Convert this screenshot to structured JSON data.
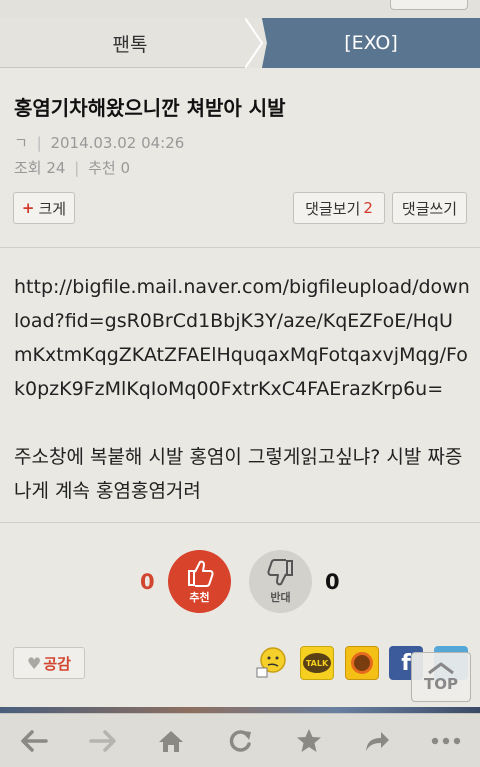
{
  "breadcrumb": {
    "home": "팬톡",
    "current": "[EXO]"
  },
  "post": {
    "title": "홍염기차해왔으니깐 쳐받아 시발",
    "author": "ㄱ",
    "date": "2014.03.02 04:26",
    "views_label": "조회",
    "views": "24",
    "recommend_label": "추천",
    "recommend": "0",
    "body_link": "http://bigfile.mail.naver.com/bigfileupload/download?fid=gsR0BrCd1BbjK3Y/aze/KqEZFoE/HqUmKxtmKqgZKAtZFAElHquqaxMqFotqaxvjMqg/Fok0pzK9FzMlKqIoMq00FxtrKxC4FAErazKrp6u=",
    "body_text": "주소창에 복붙해 시발 홍염이 그렇게읽고싶냐? 시발 짜증나게 계속 홍염홍염거려"
  },
  "actions": {
    "bigger_label": "크게",
    "view_comments_label": "댓글보기",
    "comments_count": "2",
    "write_comment_label": "댓글쓰기"
  },
  "votes": {
    "up_count": "0",
    "up_label": "추천",
    "down_label": "반대",
    "down_count": "0"
  },
  "empathy_label": "공감",
  "share": {
    "talk_label": "TALK"
  },
  "top_label": "TOP",
  "icons": [
    "back-arrow-icon",
    "forward-arrow-icon",
    "home-icon",
    "refresh-icon",
    "star-icon",
    "share-arrow-icon",
    "more-icon"
  ],
  "colors": {
    "accent_red": "#d8432c",
    "crumb_blue": "#5a7590",
    "facebook": "#3b5b9a",
    "twitter": "#55a7d8",
    "kakao": "#f5d020"
  }
}
